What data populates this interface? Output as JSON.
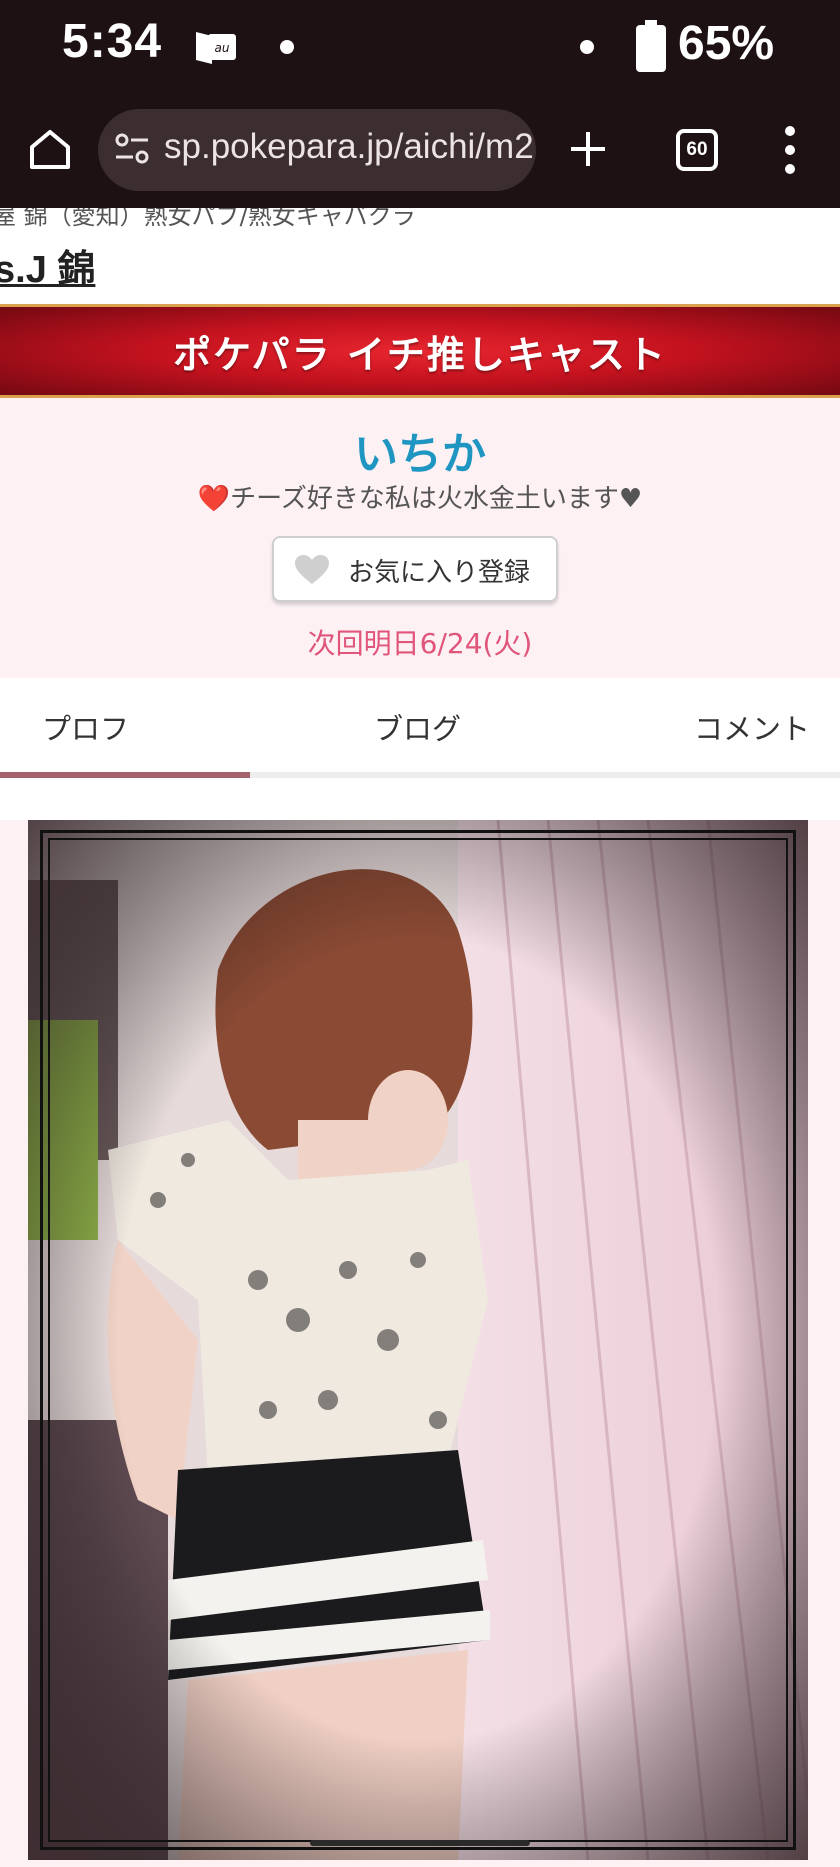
{
  "status_bar": {
    "time": "5:34",
    "carrier_icon": "au-icon",
    "battery_percent": "65%"
  },
  "browser": {
    "url": "sp.pokepara.jp/aichi/m2",
    "tab_count": "60",
    "icons": [
      "home-icon",
      "site-settings-icon",
      "new-tab-icon",
      "tab-switcher-icon",
      "more-menu-icon"
    ]
  },
  "shop": {
    "category": "屋 錦（愛知）熟女パブ/熟女キャバクラ",
    "name": "s.J 錦"
  },
  "banner": {
    "title": "ポケパラ イチ推しキャスト"
  },
  "cast": {
    "name": "いちか",
    "catchphrase": "❤️チーズ好きな私は火水金土います♥",
    "favorite_label": "お気に入り登録",
    "next_shift": "次回明日6/24(火)"
  },
  "tabs": [
    {
      "label": "プロフ",
      "active": true
    },
    {
      "label": "ブログ",
      "active": false
    },
    {
      "label": "コメント",
      "active": false
    }
  ],
  "colors": {
    "status_bg": "#1e1113",
    "banner_red": "#c4121f",
    "cast_name": "#1f95c2",
    "next_shift": "#e0557a",
    "page_pink": "#fdf1f4"
  }
}
